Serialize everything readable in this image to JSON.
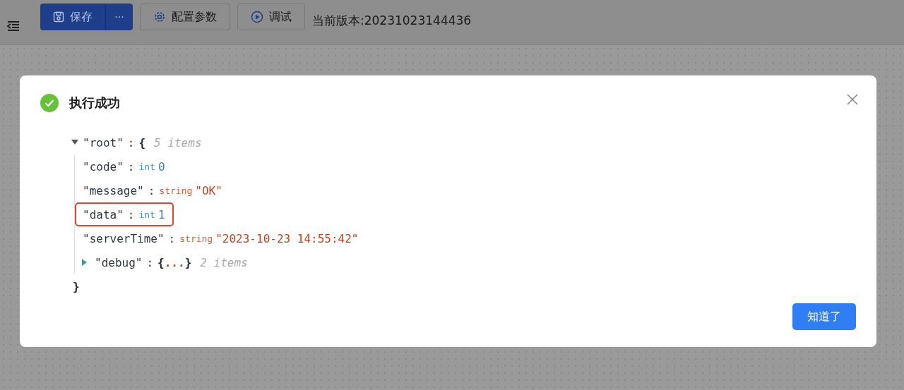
{
  "toolbar": {
    "save": {
      "label": "保存",
      "more": "···"
    },
    "config": {
      "label": "配置参数"
    },
    "debug": {
      "label": "调试"
    },
    "version": "当前版本:20231023144436"
  },
  "dialog": {
    "title": "执行成功",
    "tree": {
      "key": "\"root\"",
      "sep": ":",
      "open": "{",
      "count": "5 items",
      "expanded": true,
      "close": "}",
      "children": [
        {
          "kind": "value",
          "key": "\"code\"",
          "sep": ":",
          "type": "int",
          "value": "0",
          "is_string": false,
          "highlighted": false
        },
        {
          "kind": "value",
          "key": "\"message\"",
          "sep": ":",
          "type": "string",
          "value": "\"OK\"",
          "is_string": true,
          "highlighted": false
        },
        {
          "kind": "value",
          "key": "\"data\"",
          "sep": ":",
          "type": "int",
          "value": "1",
          "is_string": false,
          "highlighted": true
        },
        {
          "kind": "value",
          "key": "\"serverTime\"",
          "sep": ":",
          "type": "string",
          "value": "\"2023-10-23 14:55:42\"",
          "is_string": true,
          "highlighted": false
        },
        {
          "kind": "object",
          "key": "\"debug\"",
          "sep": ":",
          "open": "{",
          "ellipsis": "...",
          "close": "}",
          "count": "2 items",
          "expanded": false
        }
      ]
    },
    "ok_button": "知道了"
  }
}
